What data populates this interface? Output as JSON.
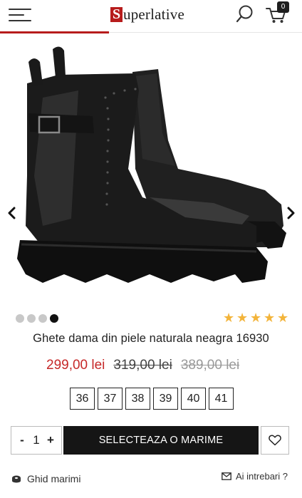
{
  "header": {
    "logo_initial": "S",
    "logo_rest": "uperlative",
    "cart_count": "0",
    "menu_icon": "hamburger-icon",
    "search_icon": "search-icon",
    "cart_icon": "cart-icon",
    "accent_color": "#b71c1c"
  },
  "gallery": {
    "image_subject": "black leather chelsea-style ankle boots with buckle strap and chunky lug sole",
    "prev_icon": "chevron-left-icon",
    "next_icon": "chevron-right-icon",
    "slide_count": 4,
    "active_slide": 4
  },
  "rating": {
    "stars": 5,
    "max": 5,
    "star_color": "#f3b43a"
  },
  "product": {
    "title": "Ghete dama din piele naturala neagra 16930",
    "price_current": "299,00 lei",
    "price_old": "319,00 lei",
    "price_old2": "389,00 lei",
    "price_color": "#c62828"
  },
  "sizes": [
    "36",
    "37",
    "38",
    "39",
    "40",
    "41"
  ],
  "purchase": {
    "qty_minus": "-",
    "qty_value": "1",
    "qty_plus": "+",
    "select_label": "SELECTEAZA O MARIME",
    "wishlist_icon": "heart-icon"
  },
  "footer_links": {
    "size_guide": "Ghid marimi",
    "ask": "Ai intrebari ?"
  }
}
